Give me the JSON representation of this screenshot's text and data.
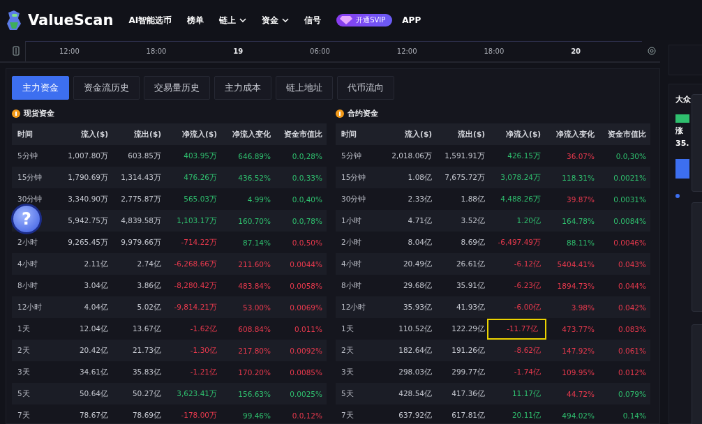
{
  "nav": {
    "brand": "ValueScan",
    "items": [
      {
        "label": "AI智能选币",
        "dropdown": false
      },
      {
        "label": "榜单",
        "dropdown": false
      },
      {
        "label": "链上",
        "dropdown": true
      },
      {
        "label": "资金",
        "dropdown": true
      },
      {
        "label": "信号",
        "dropdown": false
      }
    ],
    "vip": "开通SVIP",
    "app": "APP"
  },
  "timeline": {
    "ticks": [
      {
        "label": "12:00",
        "major": false
      },
      {
        "label": "18:00",
        "major": false
      },
      {
        "label": "19",
        "major": true
      },
      {
        "label": "06:00",
        "major": false
      },
      {
        "label": "12:00",
        "major": false
      },
      {
        "label": "18:00",
        "major": false
      },
      {
        "label": "20",
        "major": true
      }
    ]
  },
  "tabs": [
    {
      "label": "主力资金",
      "selected": true
    },
    {
      "label": "资金流历史",
      "selected": false
    },
    {
      "label": "交易量历史",
      "selected": false
    },
    {
      "label": "主力成本",
      "selected": false
    },
    {
      "label": "链上地址",
      "selected": false
    },
    {
      "label": "代币流向",
      "selected": false
    }
  ],
  "help_button": "?",
  "tables": [
    {
      "title": "现货资金",
      "columns": [
        "时间",
        "流入($)",
        "流出($)",
        "净流入($)",
        "净流入变化",
        "资金市值比"
      ],
      "rows": [
        {
          "cells": [
            {
              "text": "5分钟"
            },
            {
              "text": "1,007.80万"
            },
            {
              "text": "603.85万"
            },
            {
              "text": "403.95万",
              "color": "#2fbf6e"
            },
            {
              "text": "646.89%",
              "color": "#2fbf6e"
            },
            {
              "text": "0.0,28%",
              "color": "#2fbf6e"
            }
          ]
        },
        {
          "cells": [
            {
              "text": "15分钟"
            },
            {
              "text": "1,790.69万"
            },
            {
              "text": "1,314.43万"
            },
            {
              "text": "476.26万",
              "color": "#2fbf6e"
            },
            {
              "text": "436.52%",
              "color": "#2fbf6e"
            },
            {
              "text": "0.0,33%",
              "color": "#2fbf6e"
            }
          ]
        },
        {
          "cells": [
            {
              "text": "30分钟"
            },
            {
              "text": "3,340.90万"
            },
            {
              "text": "2,775.87万"
            },
            {
              "text": "565.03万",
              "color": "#2fbf6e"
            },
            {
              "text": "4.99%",
              "color": "#2fbf6e"
            },
            {
              "text": "0.0,40%",
              "color": "#2fbf6e"
            }
          ]
        },
        {
          "cells": [
            {
              "text": ""
            },
            {
              "text": "5,942.75万"
            },
            {
              "text": "4,839.58万"
            },
            {
              "text": "1,103.17万",
              "color": "#2fbf6e"
            },
            {
              "text": "160.70%",
              "color": "#2fbf6e"
            },
            {
              "text": "0.0,78%",
              "color": "#2fbf6e"
            }
          ]
        },
        {
          "cells": [
            {
              "text": "2小时"
            },
            {
              "text": "9,265.45万"
            },
            {
              "text": "9,979.66万"
            },
            {
              "text": "-714.22万",
              "color": "#e8394d"
            },
            {
              "text": "87.14%",
              "color": "#2fbf6e"
            },
            {
              "text": "0.0,50%",
              "color": "#e8394d"
            }
          ]
        },
        {
          "cells": [
            {
              "text": "4小时"
            },
            {
              "text": "2.11亿"
            },
            {
              "text": "2.74亿"
            },
            {
              "text": "-6,268.66万",
              "color": "#e8394d"
            },
            {
              "text": "211.60%",
              "color": "#e8394d"
            },
            {
              "text": "0.0044%",
              "color": "#e8394d"
            }
          ]
        },
        {
          "cells": [
            {
              "text": "8小时"
            },
            {
              "text": "3.04亿"
            },
            {
              "text": "3.86亿"
            },
            {
              "text": "-8,280.42万",
              "color": "#e8394d"
            },
            {
              "text": "483.84%",
              "color": "#e8394d"
            },
            {
              "text": "0.0058%",
              "color": "#e8394d"
            }
          ]
        },
        {
          "cells": [
            {
              "text": "12小时"
            },
            {
              "text": "4.04亿"
            },
            {
              "text": "5.02亿"
            },
            {
              "text": "-9,814.21万",
              "color": "#e8394d"
            },
            {
              "text": "53.00%",
              "color": "#e8394d"
            },
            {
              "text": "0.0069%",
              "color": "#e8394d"
            }
          ]
        },
        {
          "cells": [
            {
              "text": "1天"
            },
            {
              "text": "12.04亿"
            },
            {
              "text": "13.67亿"
            },
            {
              "text": "-1.62亿",
              "color": "#e8394d"
            },
            {
              "text": "608.84%",
              "color": "#e8394d"
            },
            {
              "text": "0.011%",
              "color": "#e8394d"
            }
          ]
        },
        {
          "cells": [
            {
              "text": "2天"
            },
            {
              "text": "20.42亿"
            },
            {
              "text": "21.73亿"
            },
            {
              "text": "-1.30亿",
              "color": "#e8394d"
            },
            {
              "text": "217.80%",
              "color": "#e8394d"
            },
            {
              "text": "0.0092%",
              "color": "#e8394d"
            }
          ]
        },
        {
          "cells": [
            {
              "text": "3天"
            },
            {
              "text": "34.61亿"
            },
            {
              "text": "35.83亿"
            },
            {
              "text": "-1.21亿",
              "color": "#e8394d"
            },
            {
              "text": "170.20%",
              "color": "#e8394d"
            },
            {
              "text": "0.0085%",
              "color": "#e8394d"
            }
          ]
        },
        {
          "cells": [
            {
              "text": "5天"
            },
            {
              "text": "50.64亿"
            },
            {
              "text": "50.27亿"
            },
            {
              "text": "3,623.41万",
              "color": "#2fbf6e"
            },
            {
              "text": "156.63%",
              "color": "#2fbf6e"
            },
            {
              "text": "0.0025%",
              "color": "#2fbf6e"
            }
          ]
        },
        {
          "cells": [
            {
              "text": "7天"
            },
            {
              "text": "78.67亿"
            },
            {
              "text": "78.69亿"
            },
            {
              "text": "-178.00万",
              "color": "#e8394d"
            },
            {
              "text": "99.46%",
              "color": "#2fbf6e"
            },
            {
              "text": "0.0,12%",
              "color": "#e8394d"
            }
          ]
        }
      ]
    },
    {
      "title": "合约资金",
      "columns": [
        "时间",
        "流入($)",
        "流出($)",
        "净流入($)",
        "净流入变化",
        "资金市值比"
      ],
      "rows": [
        {
          "cells": [
            {
              "text": "5分钟"
            },
            {
              "text": "2,018.06万"
            },
            {
              "text": "1,591.91万"
            },
            {
              "text": "426.15万",
              "color": "#2fbf6e"
            },
            {
              "text": "36.07%",
              "color": "#e8394d"
            },
            {
              "text": "0.0,30%",
              "color": "#2fbf6e"
            }
          ]
        },
        {
          "cells": [
            {
              "text": "15分钟"
            },
            {
              "text": "1.08亿"
            },
            {
              "text": "7,675.72万"
            },
            {
              "text": "3,078.24万",
              "color": "#2fbf6e"
            },
            {
              "text": "118.31%",
              "color": "#2fbf6e"
            },
            {
              "text": "0.0021%",
              "color": "#2fbf6e"
            }
          ]
        },
        {
          "cells": [
            {
              "text": "30分钟"
            },
            {
              "text": "2.33亿"
            },
            {
              "text": "1.88亿"
            },
            {
              "text": "4,488.26万",
              "color": "#2fbf6e"
            },
            {
              "text": "39.87%",
              "color": "#e8394d"
            },
            {
              "text": "0.0031%",
              "color": "#2fbf6e"
            }
          ]
        },
        {
          "cells": [
            {
              "text": "1小时"
            },
            {
              "text": "4.71亿"
            },
            {
              "text": "3.52亿"
            },
            {
              "text": "1.20亿",
              "color": "#2fbf6e"
            },
            {
              "text": "164.78%",
              "color": "#2fbf6e"
            },
            {
              "text": "0.0084%",
              "color": "#2fbf6e"
            }
          ]
        },
        {
          "cells": [
            {
              "text": "2小时"
            },
            {
              "text": "8.04亿"
            },
            {
              "text": "8.69亿"
            },
            {
              "text": "-6,497.49万",
              "color": "#e8394d"
            },
            {
              "text": "88.11%",
              "color": "#2fbf6e"
            },
            {
              "text": "0.0046%",
              "color": "#e8394d"
            }
          ]
        },
        {
          "cells": [
            {
              "text": "4小时"
            },
            {
              "text": "20.49亿"
            },
            {
              "text": "26.61亿"
            },
            {
              "text": "-6.12亿",
              "color": "#e8394d"
            },
            {
              "text": "5404.41%",
              "color": "#e8394d"
            },
            {
              "text": "0.043%",
              "color": "#e8394d"
            }
          ]
        },
        {
          "cells": [
            {
              "text": "8小时"
            },
            {
              "text": "29.68亿"
            },
            {
              "text": "35.91亿"
            },
            {
              "text": "-6.23亿",
              "color": "#e8394d"
            },
            {
              "text": "1894.73%",
              "color": "#e8394d"
            },
            {
              "text": "0.044%",
              "color": "#e8394d"
            }
          ]
        },
        {
          "cells": [
            {
              "text": "12小时"
            },
            {
              "text": "35.93亿"
            },
            {
              "text": "41.93亿"
            },
            {
              "text": "-6.00亿",
              "color": "#e8394d"
            },
            {
              "text": "3.98%",
              "color": "#e8394d"
            },
            {
              "text": "0.042%",
              "color": "#e8394d"
            }
          ]
        },
        {
          "cells": [
            {
              "text": "1天"
            },
            {
              "text": "110.52亿"
            },
            {
              "text": "122.29亿"
            },
            {
              "text": "-11.77亿",
              "color": "#e8394d",
              "highlighted": true
            },
            {
              "text": "473.77%",
              "color": "#e8394d"
            },
            {
              "text": "0.083%",
              "color": "#e8394d"
            }
          ]
        },
        {
          "cells": [
            {
              "text": "2天"
            },
            {
              "text": "182.64亿"
            },
            {
              "text": "191.26亿"
            },
            {
              "text": "-8.62亿",
              "color": "#e8394d"
            },
            {
              "text": "147.92%",
              "color": "#e8394d"
            },
            {
              "text": "0.061%",
              "color": "#e8394d"
            }
          ]
        },
        {
          "cells": [
            {
              "text": "3天"
            },
            {
              "text": "298.03亿"
            },
            {
              "text": "299.77亿"
            },
            {
              "text": "-1.74亿",
              "color": "#e8394d"
            },
            {
              "text": "109.95%",
              "color": "#e8394d"
            },
            {
              "text": "0.012%",
              "color": "#e8394d"
            }
          ]
        },
        {
          "cells": [
            {
              "text": "5天"
            },
            {
              "text": "428.54亿"
            },
            {
              "text": "417.36亿"
            },
            {
              "text": "11.17亿",
              "color": "#2fbf6e"
            },
            {
              "text": "44.72%",
              "color": "#e8394d"
            },
            {
              "text": "0.079%",
              "color": "#2fbf6e"
            }
          ]
        },
        {
          "cells": [
            {
              "text": "7天"
            },
            {
              "text": "637.92亿"
            },
            {
              "text": "617.81亿"
            },
            {
              "text": "20.11亿",
              "color": "#2fbf6e"
            },
            {
              "text": "494.02%",
              "color": "#2fbf6e"
            },
            {
              "text": "0.14%",
              "color": "#2fbf6e"
            }
          ]
        }
      ]
    }
  ],
  "side": {
    "title": "大众",
    "rise": "涨",
    "value": "35."
  }
}
